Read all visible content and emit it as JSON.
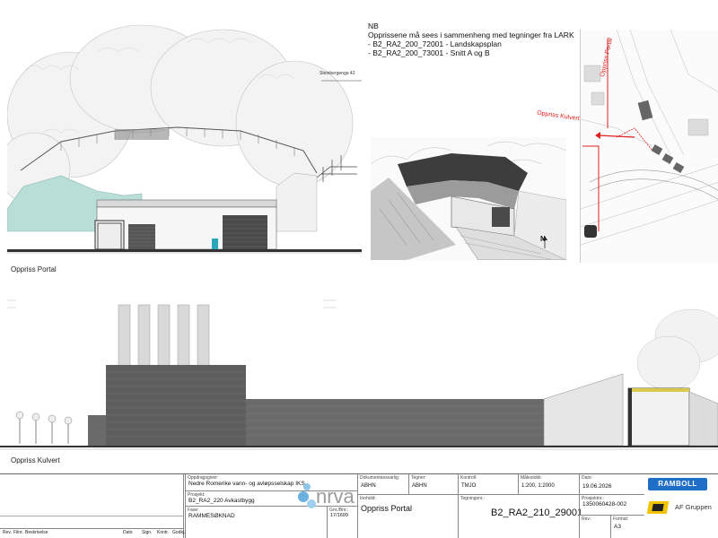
{
  "drawing": {
    "portal_caption": "Oppriss Portal",
    "kulvert_caption": "Oppriss Kulvert",
    "stair_label": "Steinbergenga 42",
    "map_label_portal": "Oppriss Portal",
    "map_label_kulvert": "Oppriss Kulvert",
    "north_symbol": "N"
  },
  "note": {
    "heading": "NB",
    "line1": "Opprissene må sees i sammenheng med tegninger fra LARK",
    "line2": "- B2_RA2_200_72001 - Landskapsplan",
    "line3": "- B2_RA2_200_73001 - Snitt A og B"
  },
  "revision_table": {
    "headers": [
      "Rev.",
      "Filnr.",
      "Beskrivelse",
      "Dato",
      "Sign.",
      "Kontr.",
      "Godkj."
    ]
  },
  "title_block": {
    "client_label": "Oppdragsgiver:",
    "client": "Nedre Romerike vann- og avløpsselskap IKS",
    "project_label": "Prosjekt:",
    "project": "B2_RA2_220 Avkastbygg",
    "phase_label": "Fase:",
    "phase": "RAMMESØKNAD",
    "gnr_label": "Gnr./Bnr.:",
    "gnr": "17/1699",
    "logo_text": "nrva",
    "doc_resp_label": "Dokumentansvarlig:",
    "doc_resp": "ABHN",
    "drawn_label": "Tegner:",
    "drawn": "ABHN",
    "control_label": "Kontroll:",
    "control": "TMJO",
    "scale_label": "Målestokk:",
    "scale": "1:200, 1:2000",
    "date_label": "Dato:",
    "date": "19.06.2026",
    "content_label": "Innhold:",
    "content": "Oppriss Portal",
    "drawing_no_label": "Tegningsnr.:",
    "drawing_no": "B2_RA2_210_29001",
    "project_no_label": "Prosjektnr.:",
    "project_no": "1350060428-002",
    "rev_label": "Rev.:",
    "rev": "",
    "format_label": "Format:",
    "format": "A3",
    "ramboll": "RAMBOLL",
    "af_gruppen": "AF Gruppen"
  }
}
